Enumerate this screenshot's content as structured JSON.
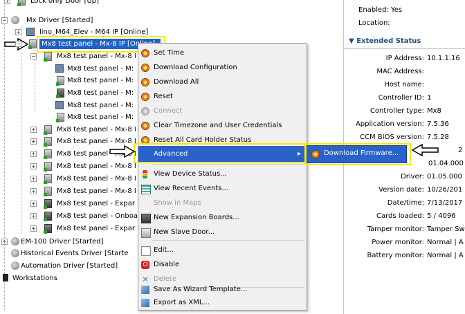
{
  "tree": {
    "items": [
      {
        "label": "Lock only Door [Up]"
      },
      {
        "label": "Mx Driver [Started]"
      },
      {
        "label": "lino_M64_Elev - M64 IP [Online]"
      },
      {
        "label": "Mx8 test panel - Mx-8 IP [Online]"
      },
      {
        "label": "Mx8 test panel - Mx-8 I"
      },
      {
        "label": "Mx8 test panel - M:"
      },
      {
        "label": "Mx8 test panel - M:"
      },
      {
        "label": "Mx8 test panel - M:"
      },
      {
        "label": "Mx8 test panel - M:"
      },
      {
        "label": "Mx8 test panel - M:"
      },
      {
        "label": "Mx8 test panel - Mx-8 I"
      },
      {
        "label": "Mx8 test panel - Mx-8 I"
      },
      {
        "label": "Mx8 test panel - Mx-8 I"
      },
      {
        "label": "Mx8 test panel - Mx-8 I"
      },
      {
        "label": "Mx8 test panel - Mx-8 I"
      },
      {
        "label": "Mx8 test panel - Mx-8 I"
      },
      {
        "label": "Mx8 test panel - Expar"
      },
      {
        "label": "Mx8 test panel - Onboa"
      },
      {
        "label": "Mx8 test panel - Expar"
      },
      {
        "label": "EM-100 Driver [Started]"
      },
      {
        "label": "Historical Events Driver [Starte"
      },
      {
        "label": "Automation Driver [Started]"
      },
      {
        "label": "Workstations"
      }
    ]
  },
  "menu": {
    "items": [
      {
        "label": "Set Time",
        "icon": "gear-icon",
        "disabled": false
      },
      {
        "label": "Download Configuration",
        "icon": "gear-icon",
        "disabled": false
      },
      {
        "label": "Download All",
        "icon": "gear-icon",
        "disabled": false
      },
      {
        "label": "Reset",
        "icon": "gear-icon",
        "disabled": false
      },
      {
        "label": "Connect",
        "icon": "gear-icon",
        "disabled": true
      },
      {
        "label": "Clear Timezone and User Credentials",
        "icon": "gear-icon",
        "disabled": false
      },
      {
        "label": "Reset All Card Holder Status",
        "icon": "gear-icon",
        "disabled": false
      },
      {
        "label": "Advanced",
        "icon": "",
        "disabled": false
      },
      {
        "label": "View Device Status...",
        "icon": "status-icon",
        "disabled": false
      },
      {
        "label": "View Recent Events...",
        "icon": "events-icon",
        "disabled": false
      },
      {
        "label": "Show in Maps",
        "icon": "",
        "disabled": true
      },
      {
        "label": "New Expansion Boards...",
        "icon": "board-icon",
        "disabled": false
      },
      {
        "label": "New Slave Door...",
        "icon": "door-icon",
        "disabled": false
      },
      {
        "label": "Edit...",
        "icon": "edit-icon",
        "disabled": false
      },
      {
        "label": "Disable",
        "icon": "disable-icon",
        "disabled": false
      },
      {
        "label": "Delete",
        "icon": "delete-icon",
        "disabled": true
      },
      {
        "label": "Save As Wizard Template...",
        "icon": "template-icon",
        "disabled": false
      },
      {
        "label": "Export as XML...",
        "icon": "export-icon",
        "disabled": false
      }
    ],
    "submenu_label": "Download Firmware..."
  },
  "right_panel": {
    "enabled": "Enabled: Yes",
    "location": "Location:",
    "section_title": "Extended Status",
    "fields": [
      {
        "key": "IP Address:",
        "value": "10.1.1.16"
      },
      {
        "key": "MAC Address:",
        "value": ""
      },
      {
        "key": "Host name:",
        "value": ""
      },
      {
        "key": "Controller ID:",
        "value": "1"
      },
      {
        "key": "Controller type:",
        "value": "Mx8"
      },
      {
        "key": "Application version:",
        "value": "7.5.36"
      },
      {
        "key": "CCM BIOS version:",
        "value": "7.5.28"
      },
      {
        "key": "",
        "value": "2"
      },
      {
        "key": "",
        "value": "01.04.000"
      },
      {
        "key": "Driver:",
        "value": "01.05.000"
      },
      {
        "key": "Version date:",
        "value": "10/26/201"
      },
      {
        "key": "Date/time:",
        "value": "7/13/2017"
      },
      {
        "key": "Cards loaded:",
        "value": "5 / 4096"
      },
      {
        "key": "Tamper monitor:",
        "value": "Tamper Sw"
      },
      {
        "key": "Power monitor:",
        "value": "Normal | A"
      },
      {
        "key": "Battery monitor:",
        "value": "Normal | A"
      }
    ]
  },
  "colors": {
    "highlight": "#2a62c9",
    "callout": "#f2ec00",
    "section": "#1c4f8a"
  }
}
